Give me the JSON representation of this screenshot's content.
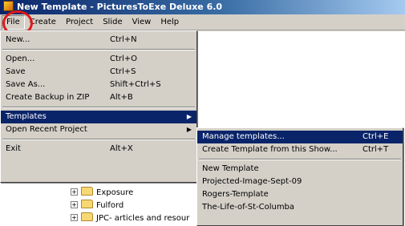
{
  "window": {
    "title": "New Template - PicturesToExe Deluxe 6.0",
    "icon": "pte-app-icon"
  },
  "menubar": {
    "items": [
      "File",
      "Create",
      "Project",
      "Slide",
      "View",
      "Help"
    ]
  },
  "file_menu": {
    "items": [
      {
        "label": "New...",
        "shortcut": "Ctrl+N"
      },
      {
        "label": "Open...",
        "shortcut": "Ctrl+O"
      },
      {
        "label": "Save",
        "shortcut": "Ctrl+S"
      },
      {
        "label": "Save As...",
        "shortcut": "Shift+Ctrl+S"
      },
      {
        "label": "Create Backup in ZIP",
        "shortcut": "Alt+B"
      },
      {
        "label": "Templates",
        "shortcut": ""
      },
      {
        "label": "Open Recent Project",
        "shortcut": ""
      },
      {
        "label": "Exit",
        "shortcut": "Alt+X"
      }
    ],
    "highlighted": "Templates"
  },
  "templates_submenu": {
    "items": [
      {
        "label": "Manage templates...",
        "shortcut": "Ctrl+E"
      },
      {
        "label": "Create Template from this Show...",
        "shortcut": "Ctrl+T"
      },
      {
        "label": "New Template",
        "shortcut": ""
      },
      {
        "label": "Projected-Image-Sept-09",
        "shortcut": ""
      },
      {
        "label": "Rogers-Template",
        "shortcut": ""
      },
      {
        "label": "The-Life-of-St-Columba",
        "shortcut": ""
      }
    ],
    "highlighted": "Manage templates..."
  },
  "tree": {
    "items": [
      "Exposure",
      "Fulford",
      "JPC- articles and resour"
    ]
  },
  "colors": {
    "highlight": "#0a246a",
    "annotation_circle": "#e01818"
  }
}
